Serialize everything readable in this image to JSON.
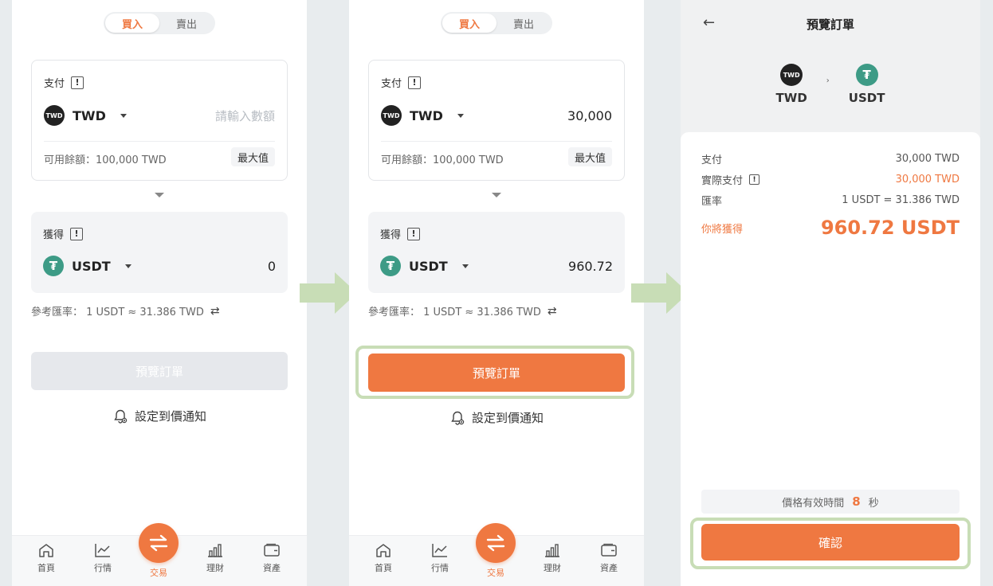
{
  "toggle": {
    "buy": "買入",
    "sell": "賣出"
  },
  "pay": {
    "label": "支付",
    "info_mark": "!",
    "currency_icon_text": "TWD",
    "currency": "TWD",
    "placeholder": "請輸入數額",
    "amount_filled": "30,000",
    "balance": "可用餘額：100,000 TWD",
    "max_label": "最大值"
  },
  "get": {
    "label": "獲得",
    "info_mark": "!",
    "currency_icon_text": "₮",
    "currency": "USDT",
    "amount_empty": "0",
    "amount_filled": "960.72"
  },
  "rate": {
    "text": "參考匯率： 1 USDT ≈ 31.386 TWD",
    "swap_icon": "⇄"
  },
  "preview_button": "預覽訂單",
  "notify": {
    "label": "設定到價通知",
    "icon": "bell-icon"
  },
  "nav": {
    "home": "首頁",
    "market": "行情",
    "trade": "交易",
    "finance": "理財",
    "assets": "資產"
  },
  "preview": {
    "back_icon": "←",
    "title": "預覽訂單",
    "pair": {
      "from": "TWD",
      "from_icon_text": "TWD",
      "sep": "›",
      "to": "USDT",
      "to_icon_text": "₮"
    },
    "rows": {
      "pay_label": "支付",
      "pay_value": "30,000 TWD",
      "actual_label": "實際支付",
      "actual_value": "30,000 TWD",
      "rate_label": "匯率",
      "rate_value": "1 USDT = 31.386 TWD",
      "receive_label": "你將獲得",
      "receive_value": "960.72 USDT"
    },
    "timer": {
      "label": "價格有效時間",
      "seconds": "8",
      "unit": "秒"
    },
    "confirm": "確認"
  },
  "colors": {
    "accent": "#ef7841",
    "highlight": "#c8ddb6",
    "usdt": "#3d9b86"
  }
}
